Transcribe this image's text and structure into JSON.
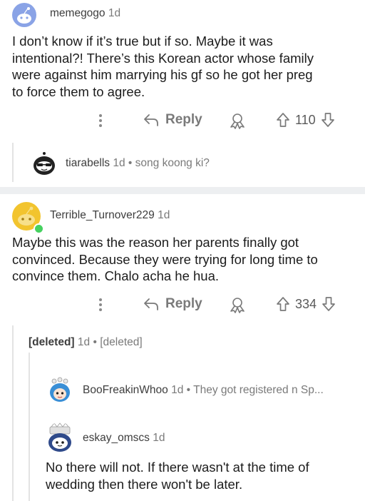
{
  "comments": [
    {
      "username": "memegogo",
      "age": "1d",
      "body": [
        "I don’t know if it’s true but if so. Maybe it was",
        "intentional?! There’s this Korean actor whose family",
        "were against him marrying his gf so he got her preg",
        "to force them to agree."
      ],
      "reply_label": "Reply",
      "score": "110"
    },
    {
      "username": "tiarabells",
      "age": "1d",
      "collapsed_text": "song koong ki?"
    },
    {
      "username": "Terrible_Turnover229",
      "age": "1d",
      "body": [
        "Maybe this was the reason her parents finally got",
        "convinced. Because they were trying for long time to",
        "convince them. Chalo acha he hua."
      ],
      "reply_label": "Reply",
      "score": "334"
    },
    {
      "username": "[deleted]",
      "age": "1d",
      "collapsed_text": "[deleted]"
    },
    {
      "username": "BooFreakinWhoo",
      "age": "1d",
      "collapsed_text": "They got registered n Sp..."
    },
    {
      "username": "eskay_omscs",
      "age": "1d",
      "body": [
        "No there will not. If there wasn't at the time of",
        "wedding then there won't be later."
      ]
    }
  ],
  "separator": "•",
  "colors": {
    "snoo_blue": "#8aa3e6",
    "snoo_yellow": "#f2c42e",
    "online_green": "#46d160"
  },
  "icons": [
    "snoo-avatar",
    "more-options-icon",
    "reply-icon",
    "award-icon",
    "upvote-icon",
    "downvote-icon",
    "online-dot"
  ]
}
